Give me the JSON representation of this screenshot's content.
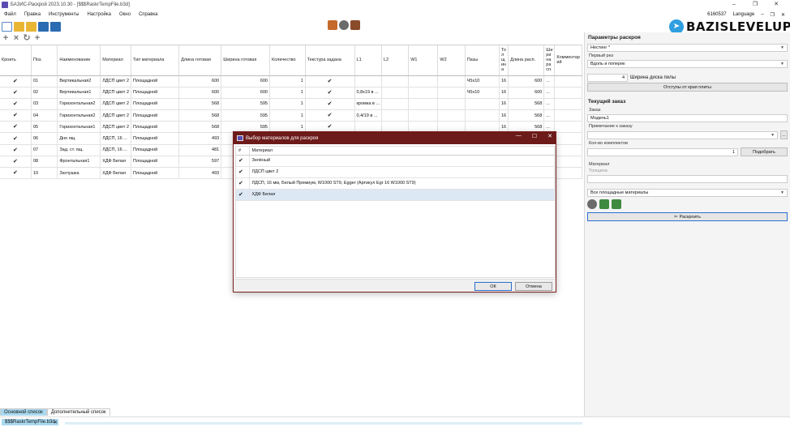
{
  "window": {
    "title": "БАЗИС-Раскрой 2023.10.30 - [$$$RaskrTempFile.b3d]",
    "controls": [
      "–",
      "❐",
      "✕"
    ]
  },
  "menu": {
    "items": [
      "Файл",
      "Правка",
      "Инструменты",
      "Настройка",
      "Окно",
      "Справка"
    ],
    "right_code": "6160537",
    "language": "Language",
    "right_controls": [
      "–",
      "❐",
      "✕"
    ]
  },
  "brand": {
    "text": "BAZISLEVELUP",
    "icon": "telegram-icon",
    "color": "#2f9fe0"
  },
  "table": {
    "headers": [
      "Кроить",
      "Поз.",
      "Наименование",
      "Материал",
      "Тип материала",
      "Длина готовая",
      "Ширина готовая",
      "Количество",
      "Текстура задана",
      "L1",
      "L2",
      "W1",
      "W2",
      "Пазы",
      "То л щ ин а",
      "Длина расп.",
      "Ши ри на ра сп.",
      "Комментар ий"
    ],
    "rows": [
      {
        "cut": true,
        "pos": "01",
        "name": "Вертикальная2",
        "material": "ЛДСП цвет 2",
        "type": "Площадной",
        "length": "600",
        "width": "600",
        "qty": "1",
        "texture": true,
        "l1": "",
        "l2": "",
        "w1": "",
        "w2": "",
        "grooves": "Ч5х10",
        "thick": "16",
        "len_cut": "600",
        "width_cut": "...",
        "comment": ""
      },
      {
        "cut": true,
        "pos": "02",
        "name": "Вертикальная1",
        "material": "ЛДСП цвет 2",
        "type": "Площадной",
        "length": "600",
        "width": "600",
        "qty": "1",
        "texture": true,
        "l1": "0,8x19 в ...",
        "l2": "",
        "w1": "",
        "w2": "",
        "grooves": "Ч5х10",
        "thick": "16",
        "len_cut": "600",
        "width_cut": "...",
        "comment": ""
      },
      {
        "cut": true,
        "pos": "03",
        "name": "Горизонтальная2",
        "material": "ЛДСП цвет 2",
        "type": "Площадной",
        "length": "568",
        "width": "595",
        "qty": "1",
        "texture": true,
        "l1": "кромка в ...",
        "l2": "",
        "w1": "",
        "w2": "",
        "grooves": "",
        "thick": "16",
        "len_cut": "568",
        "width_cut": "...",
        "comment": ""
      },
      {
        "cut": true,
        "pos": "04",
        "name": "Горизонтальная2",
        "material": "ЛДСП цвет 2",
        "type": "Площадной",
        "length": "568",
        "width": "595",
        "qty": "1",
        "texture": true,
        "l1": "0,4/19 в ...",
        "l2": "",
        "w1": "",
        "w2": "",
        "grooves": "",
        "thick": "16",
        "len_cut": "568",
        "width_cut": "...",
        "comment": ""
      },
      {
        "cut": true,
        "pos": "05",
        "name": "Горизонтальная1",
        "material": "ЛДСП цвет 2",
        "type": "Площадной",
        "length": "568",
        "width": "595",
        "qty": "1",
        "texture": true,
        "l1": "",
        "l2": "",
        "w1": "",
        "w2": "",
        "grooves": "",
        "thick": "16",
        "len_cut": "568",
        "width_cut": "...",
        "comment": ""
      },
      {
        "cut": true,
        "pos": "06",
        "name": "Дно ящ.",
        "material": "ЛДСП, 16 ...",
        "type": "Площадной",
        "length": "493",
        "width": "",
        "qty": "",
        "texture": false,
        "l1": "",
        "l2": "",
        "w1": "",
        "w2": "",
        "grooves": "",
        "thick": "",
        "len_cut": "",
        "width_cut": "",
        "comment": ""
      },
      {
        "cut": true,
        "pos": "07",
        "name": "Зад. ст. ящ.",
        "material": "ЛДСП, 16 ...",
        "type": "Площадной",
        "length": "481",
        "width": "",
        "qty": "",
        "texture": false,
        "l1": "",
        "l2": "",
        "w1": "",
        "w2": "",
        "grooves": "",
        "thick": "",
        "len_cut": "",
        "width_cut": "",
        "comment": ""
      },
      {
        "cut": true,
        "pos": "08",
        "name": "Фронтальная1",
        "material": "ХДФ Белая",
        "type": "Площадной",
        "length": "597",
        "width": "",
        "qty": "",
        "texture": false,
        "l1": "",
        "l2": "",
        "w1": "",
        "w2": "",
        "grooves": "",
        "thick": "",
        "len_cut": "",
        "width_cut": "",
        "comment": ""
      },
      {
        "cut": true,
        "pos": "10",
        "name": "Заглушка",
        "material": "ХДФ Белая",
        "type": "Площадной",
        "length": "493",
        "width": "",
        "qty": "",
        "texture": false,
        "l1": "",
        "l2": "",
        "w1": "",
        "w2": "",
        "grooves": "",
        "thick": "",
        "len_cut": "",
        "width_cut": "",
        "comment": ""
      }
    ]
  },
  "bottom_tabs": [
    "Основной список",
    "Дополнительный список"
  ],
  "status_tab": "$$$RaskrTempFile.b3d",
  "status_close": "✕",
  "right_panel": {
    "params_header": "Параметры раскроя",
    "nesting": "Нестинг *",
    "first_cut_label": "Первый рез",
    "first_cut_value": "Вдоль и поперек",
    "saw_width_value": "4",
    "saw_width_label": "Ширина диска пилы",
    "edge_offsets_button": "Отступы от края плиты",
    "order_header": "Текущий заказ",
    "order_label": "Заказ",
    "order_value": "Модель1",
    "order_note_label": "Примечание к заказу",
    "order_note_value": "",
    "ellipsis": "...",
    "kits_label": "Кол-во комплектов",
    "kits_value": "1",
    "pick_button": "Подобрать",
    "material_label": "Материал",
    "thickness_label": "Толщина",
    "materials_select": "Все площадные материалы",
    "cut_button": "Раскроить"
  },
  "dialog": {
    "title": "Выбор материалов для раскроя",
    "controls": [
      "—",
      "☐",
      "✕"
    ],
    "col_hash": "#",
    "col_material": "Материал",
    "rows": [
      {
        "checked": true,
        "name": "Зелёный"
      },
      {
        "checked": true,
        "name": "ЛДСП цвет 2"
      },
      {
        "checked": true,
        "name": "ЛДСП, 16 мм, Белый Премиум, W1000 ST9, Egger (Артикул Egr 16 W1000 ST9)"
      },
      {
        "checked": true,
        "name": "ХДФ Белая"
      }
    ],
    "ok": "ОК",
    "cancel": "Отмена"
  }
}
